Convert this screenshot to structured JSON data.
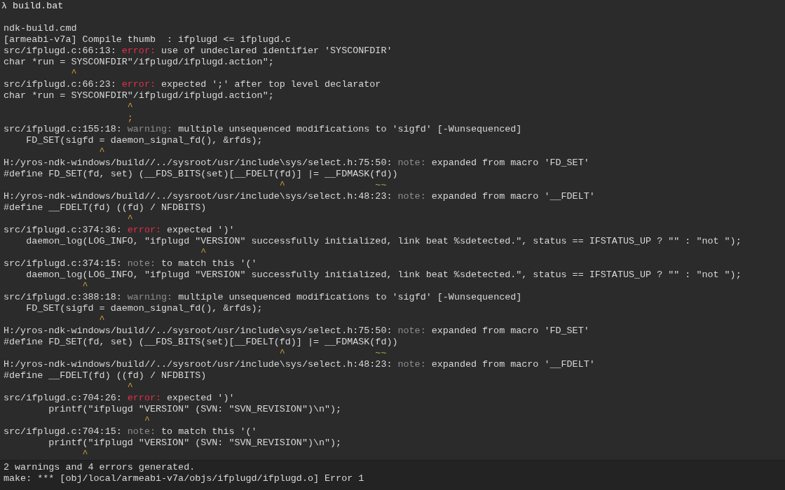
{
  "terminal": {
    "prompt": "λ build.bat",
    "output": [
      [
        {
          "text": "ndk-build.cmd",
          "kind": "text"
        }
      ],
      [
        {
          "text": "[armeabi-v7a] Compile thumb  : ifplugd <= ifplugd.c",
          "kind": "text"
        }
      ],
      [
        {
          "text": "src/ifplugd.c:66:13: ",
          "kind": "text"
        },
        {
          "text": "error:",
          "kind": "error"
        },
        {
          "text": " use of undeclared identifier 'SYSCONFDIR'",
          "kind": "text"
        }
      ],
      [
        {
          "text": "char *run = SYSCONFDIR\"/ifplugd/ifplugd.action\";",
          "kind": "text"
        }
      ],
      [
        {
          "text": "            ^",
          "kind": "caret"
        }
      ],
      [
        {
          "text": "src/ifplugd.c:66:23: ",
          "kind": "text"
        },
        {
          "text": "error:",
          "kind": "error"
        },
        {
          "text": " expected ';' after top level declarator",
          "kind": "text"
        }
      ],
      [
        {
          "text": "char *run = SYSCONFDIR\"/ifplugd/ifplugd.action\";",
          "kind": "text"
        }
      ],
      [
        {
          "text": "                      ^",
          "kind": "caret"
        }
      ],
      [
        {
          "text": "                      ;",
          "kind": "caret"
        }
      ],
      [
        {
          "text": "src/ifplugd.c:155:18: ",
          "kind": "text"
        },
        {
          "text": "warning:",
          "kind": "note"
        },
        {
          "text": " multiple unsequenced modifications to 'sigfd' [-Wunsequenced]",
          "kind": "text"
        }
      ],
      [
        {
          "text": "    FD_SET(sigfd = daemon_signal_fd(), &rfds);",
          "kind": "text"
        }
      ],
      [
        {
          "text": "                 ^",
          "kind": "caret"
        }
      ],
      [
        {
          "text": "H:/yros-ndk-windows/build//../sysroot/usr/include\\sys/select.h:75:50: ",
          "kind": "text"
        },
        {
          "text": "note:",
          "kind": "note"
        },
        {
          "text": " expanded from macro 'FD_SET'",
          "kind": "text"
        }
      ],
      [
        {
          "text": "#define FD_SET(fd, set) (__FDS_BITS(set)[__FDELT(fd)] |= __FDMASK(fd))",
          "kind": "text"
        }
      ],
      [
        {
          "text": "                                                 ^",
          "kind": "caret"
        },
        {
          "text": "                ~~",
          "kind": "range"
        }
      ],
      [
        {
          "text": "H:/yros-ndk-windows/build//../sysroot/usr/include\\sys/select.h:48:23: ",
          "kind": "text"
        },
        {
          "text": "note:",
          "kind": "note"
        },
        {
          "text": " expanded from macro '__FDELT'",
          "kind": "text"
        }
      ],
      [
        {
          "text": "#define __FDELT(fd) ((fd) / NFDBITS)",
          "kind": "text"
        }
      ],
      [
        {
          "text": "                      ^",
          "kind": "caret"
        }
      ],
      [
        {
          "text": "src/ifplugd.c:374:36: ",
          "kind": "text"
        },
        {
          "text": "error:",
          "kind": "error"
        },
        {
          "text": " expected ')'",
          "kind": "text"
        }
      ],
      [
        {
          "text": "    daemon_log(LOG_INFO, \"ifplugd \"VERSION\" successfully initialized, link beat %sdetected.\", status == IFSTATUS_UP ? \"\" : \"not \");",
          "kind": "text"
        }
      ],
      [
        {
          "text": "                                   ^",
          "kind": "caret"
        }
      ],
      [
        {
          "text": "src/ifplugd.c:374:15: ",
          "kind": "text"
        },
        {
          "text": "note:",
          "kind": "note"
        },
        {
          "text": " to match this '('",
          "kind": "text"
        }
      ],
      [
        {
          "text": "    daemon_log(LOG_INFO, \"ifplugd \"VERSION\" successfully initialized, link beat %sdetected.\", status == IFSTATUS_UP ? \"\" : \"not \");",
          "kind": "text"
        }
      ],
      [
        {
          "text": "              ^",
          "kind": "caret"
        }
      ],
      [
        {
          "text": "src/ifplugd.c:388:18: ",
          "kind": "text"
        },
        {
          "text": "warning:",
          "kind": "note"
        },
        {
          "text": " multiple unsequenced modifications to 'sigfd' [-Wunsequenced]",
          "kind": "text"
        }
      ],
      [
        {
          "text": "    FD_SET(sigfd = daemon_signal_fd(), &rfds);",
          "kind": "text"
        }
      ],
      [
        {
          "text": "                 ^",
          "kind": "caret"
        }
      ],
      [
        {
          "text": "H:/yros-ndk-windows/build//../sysroot/usr/include\\sys/select.h:75:50: ",
          "kind": "text"
        },
        {
          "text": "note:",
          "kind": "note"
        },
        {
          "text": " expanded from macro 'FD_SET'",
          "kind": "text"
        }
      ],
      [
        {
          "text": "#define FD_SET(fd, set) (__FDS_BITS(set)[__FDELT(fd)] |= __FDMASK(fd))",
          "kind": "text"
        }
      ],
      [
        {
          "text": "                                                 ^",
          "kind": "caret"
        },
        {
          "text": "                ~~",
          "kind": "range"
        }
      ],
      [
        {
          "text": "H:/yros-ndk-windows/build//../sysroot/usr/include\\sys/select.h:48:23: ",
          "kind": "text"
        },
        {
          "text": "note:",
          "kind": "note"
        },
        {
          "text": " expanded from macro '__FDELT'",
          "kind": "text"
        }
      ],
      [
        {
          "text": "#define __FDELT(fd) ((fd) / NFDBITS)",
          "kind": "text"
        }
      ],
      [
        {
          "text": "                      ^",
          "kind": "caret"
        }
      ],
      [
        {
          "text": "src/ifplugd.c:704:26: ",
          "kind": "text"
        },
        {
          "text": "error:",
          "kind": "error"
        },
        {
          "text": " expected ')'",
          "kind": "text"
        }
      ],
      [
        {
          "text": "        printf(\"ifplugd \"VERSION\" (SVN: \"SVN_REVISION\")\\n\");",
          "kind": "text"
        }
      ],
      [
        {
          "text": "                         ^",
          "kind": "caret"
        }
      ],
      [
        {
          "text": "src/ifplugd.c:704:15: ",
          "kind": "text"
        },
        {
          "text": "note:",
          "kind": "note"
        },
        {
          "text": " to match this '('",
          "kind": "text"
        }
      ],
      [
        {
          "text": "        printf(\"ifplugd \"VERSION\" (SVN: \"SVN_REVISION\")\\n\");",
          "kind": "text"
        }
      ],
      [
        {
          "text": "              ^",
          "kind": "caret"
        }
      ]
    ],
    "summary": [
      [
        {
          "text": "2 warnings and 4 errors generated.",
          "kind": "text"
        }
      ],
      [
        {
          "text": "make: *** [obj/local/armeabi-v7a/objs/ifplugd/ifplugd.o] Error 1",
          "kind": "text"
        }
      ]
    ]
  }
}
